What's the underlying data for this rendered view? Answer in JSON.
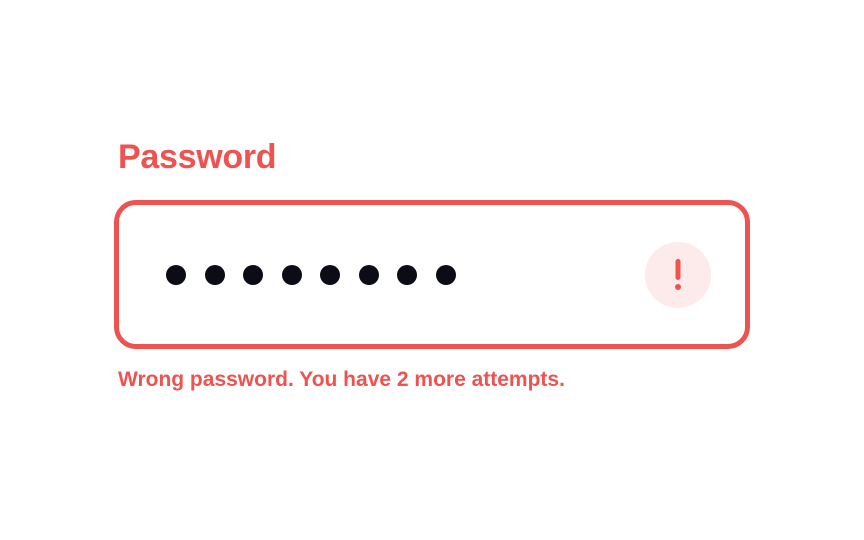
{
  "form": {
    "password_label": "Password",
    "password_value_masked": "••••••••",
    "error_icon": "exclamation-icon",
    "error_message": "Wrong password. You have 2 more attempts."
  },
  "colors": {
    "error": "#ef5350",
    "error_icon_background": "#fdeaea",
    "text": "#0c0c16",
    "background": "#ffffff"
  }
}
